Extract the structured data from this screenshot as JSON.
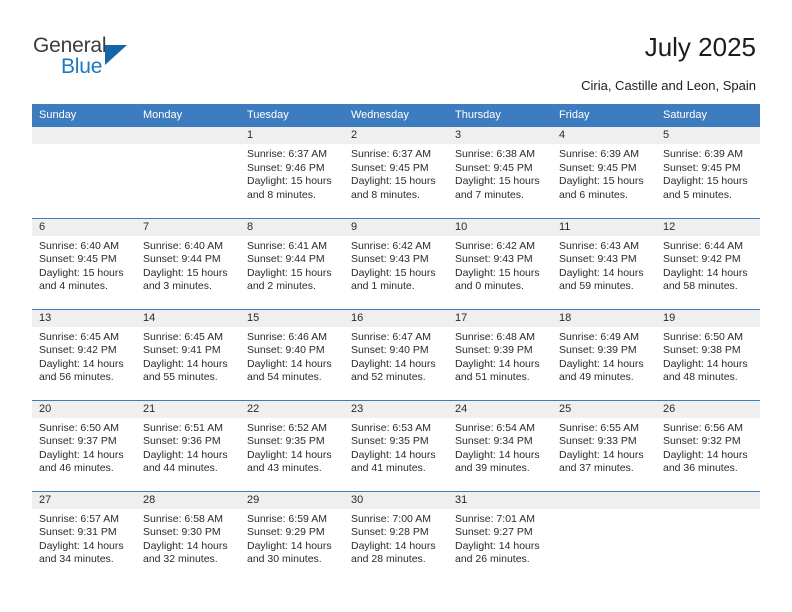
{
  "brand": {
    "name_top": "General",
    "name_bottom": "Blue",
    "triangle_icon": "blue-triangle-logo-mark",
    "color_dark": "#3c3c3c",
    "color_blue": "#1a7bc4"
  },
  "header": {
    "title": "July 2025",
    "subtitle": "Ciria, Castille and Leon, Spain"
  },
  "theme": {
    "header_blue": "#3d7cbe",
    "daynum_band": "#efefef",
    "text": "#2b2b2b"
  },
  "calendar": {
    "weekday_headers": [
      "Sunday",
      "Monday",
      "Tuesday",
      "Wednesday",
      "Thursday",
      "Friday",
      "Saturday"
    ],
    "labels": {
      "sunrise": "Sunrise:",
      "sunset": "Sunset:",
      "daylight": "Daylight:"
    },
    "weeks": [
      [
        {
          "day": "",
          "empty": true
        },
        {
          "day": "",
          "empty": true
        },
        {
          "day": "1",
          "sunrise": "Sunrise: 6:37 AM",
          "sunset": "Sunset: 9:46 PM",
          "daylight_1": "Daylight: 15 hours",
          "daylight_2": "and 8 minutes."
        },
        {
          "day": "2",
          "sunrise": "Sunrise: 6:37 AM",
          "sunset": "Sunset: 9:45 PM",
          "daylight_1": "Daylight: 15 hours",
          "daylight_2": "and 8 minutes."
        },
        {
          "day": "3",
          "sunrise": "Sunrise: 6:38 AM",
          "sunset": "Sunset: 9:45 PM",
          "daylight_1": "Daylight: 15 hours",
          "daylight_2": "and 7 minutes."
        },
        {
          "day": "4",
          "sunrise": "Sunrise: 6:39 AM",
          "sunset": "Sunset: 9:45 PM",
          "daylight_1": "Daylight: 15 hours",
          "daylight_2": "and 6 minutes."
        },
        {
          "day": "5",
          "sunrise": "Sunrise: 6:39 AM",
          "sunset": "Sunset: 9:45 PM",
          "daylight_1": "Daylight: 15 hours",
          "daylight_2": "and 5 minutes."
        }
      ],
      [
        {
          "day": "6",
          "sunrise": "Sunrise: 6:40 AM",
          "sunset": "Sunset: 9:45 PM",
          "daylight_1": "Daylight: 15 hours",
          "daylight_2": "and 4 minutes."
        },
        {
          "day": "7",
          "sunrise": "Sunrise: 6:40 AM",
          "sunset": "Sunset: 9:44 PM",
          "daylight_1": "Daylight: 15 hours",
          "daylight_2": "and 3 minutes."
        },
        {
          "day": "8",
          "sunrise": "Sunrise: 6:41 AM",
          "sunset": "Sunset: 9:44 PM",
          "daylight_1": "Daylight: 15 hours",
          "daylight_2": "and 2 minutes."
        },
        {
          "day": "9",
          "sunrise": "Sunrise: 6:42 AM",
          "sunset": "Sunset: 9:43 PM",
          "daylight_1": "Daylight: 15 hours",
          "daylight_2": "and 1 minute."
        },
        {
          "day": "10",
          "sunrise": "Sunrise: 6:42 AM",
          "sunset": "Sunset: 9:43 PM",
          "daylight_1": "Daylight: 15 hours",
          "daylight_2": "and 0 minutes."
        },
        {
          "day": "11",
          "sunrise": "Sunrise: 6:43 AM",
          "sunset": "Sunset: 9:43 PM",
          "daylight_1": "Daylight: 14 hours",
          "daylight_2": "and 59 minutes."
        },
        {
          "day": "12",
          "sunrise": "Sunrise: 6:44 AM",
          "sunset": "Sunset: 9:42 PM",
          "daylight_1": "Daylight: 14 hours",
          "daylight_2": "and 58 minutes."
        }
      ],
      [
        {
          "day": "13",
          "sunrise": "Sunrise: 6:45 AM",
          "sunset": "Sunset: 9:42 PM",
          "daylight_1": "Daylight: 14 hours",
          "daylight_2": "and 56 minutes."
        },
        {
          "day": "14",
          "sunrise": "Sunrise: 6:45 AM",
          "sunset": "Sunset: 9:41 PM",
          "daylight_1": "Daylight: 14 hours",
          "daylight_2": "and 55 minutes."
        },
        {
          "day": "15",
          "sunrise": "Sunrise: 6:46 AM",
          "sunset": "Sunset: 9:40 PM",
          "daylight_1": "Daylight: 14 hours",
          "daylight_2": "and 54 minutes."
        },
        {
          "day": "16",
          "sunrise": "Sunrise: 6:47 AM",
          "sunset": "Sunset: 9:40 PM",
          "daylight_1": "Daylight: 14 hours",
          "daylight_2": "and 52 minutes."
        },
        {
          "day": "17",
          "sunrise": "Sunrise: 6:48 AM",
          "sunset": "Sunset: 9:39 PM",
          "daylight_1": "Daylight: 14 hours",
          "daylight_2": "and 51 minutes."
        },
        {
          "day": "18",
          "sunrise": "Sunrise: 6:49 AM",
          "sunset": "Sunset: 9:39 PM",
          "daylight_1": "Daylight: 14 hours",
          "daylight_2": "and 49 minutes."
        },
        {
          "day": "19",
          "sunrise": "Sunrise: 6:50 AM",
          "sunset": "Sunset: 9:38 PM",
          "daylight_1": "Daylight: 14 hours",
          "daylight_2": "and 48 minutes."
        }
      ],
      [
        {
          "day": "20",
          "sunrise": "Sunrise: 6:50 AM",
          "sunset": "Sunset: 9:37 PM",
          "daylight_1": "Daylight: 14 hours",
          "daylight_2": "and 46 minutes."
        },
        {
          "day": "21",
          "sunrise": "Sunrise: 6:51 AM",
          "sunset": "Sunset: 9:36 PM",
          "daylight_1": "Daylight: 14 hours",
          "daylight_2": "and 44 minutes."
        },
        {
          "day": "22",
          "sunrise": "Sunrise: 6:52 AM",
          "sunset": "Sunset: 9:35 PM",
          "daylight_1": "Daylight: 14 hours",
          "daylight_2": "and 43 minutes."
        },
        {
          "day": "23",
          "sunrise": "Sunrise: 6:53 AM",
          "sunset": "Sunset: 9:35 PM",
          "daylight_1": "Daylight: 14 hours",
          "daylight_2": "and 41 minutes."
        },
        {
          "day": "24",
          "sunrise": "Sunrise: 6:54 AM",
          "sunset": "Sunset: 9:34 PM",
          "daylight_1": "Daylight: 14 hours",
          "daylight_2": "and 39 minutes."
        },
        {
          "day": "25",
          "sunrise": "Sunrise: 6:55 AM",
          "sunset": "Sunset: 9:33 PM",
          "daylight_1": "Daylight: 14 hours",
          "daylight_2": "and 37 minutes."
        },
        {
          "day": "26",
          "sunrise": "Sunrise: 6:56 AM",
          "sunset": "Sunset: 9:32 PM",
          "daylight_1": "Daylight: 14 hours",
          "daylight_2": "and 36 minutes."
        }
      ],
      [
        {
          "day": "27",
          "sunrise": "Sunrise: 6:57 AM",
          "sunset": "Sunset: 9:31 PM",
          "daylight_1": "Daylight: 14 hours",
          "daylight_2": "and 34 minutes."
        },
        {
          "day": "28",
          "sunrise": "Sunrise: 6:58 AM",
          "sunset": "Sunset: 9:30 PM",
          "daylight_1": "Daylight: 14 hours",
          "daylight_2": "and 32 minutes."
        },
        {
          "day": "29",
          "sunrise": "Sunrise: 6:59 AM",
          "sunset": "Sunset: 9:29 PM",
          "daylight_1": "Daylight: 14 hours",
          "daylight_2": "and 30 minutes."
        },
        {
          "day": "30",
          "sunrise": "Sunrise: 7:00 AM",
          "sunset": "Sunset: 9:28 PM",
          "daylight_1": "Daylight: 14 hours",
          "daylight_2": "and 28 minutes."
        },
        {
          "day": "31",
          "sunrise": "Sunrise: 7:01 AM",
          "sunset": "Sunset: 9:27 PM",
          "daylight_1": "Daylight: 14 hours",
          "daylight_2": "and 26 minutes."
        },
        {
          "day": "",
          "empty": true
        },
        {
          "day": "",
          "empty": true
        }
      ]
    ]
  }
}
